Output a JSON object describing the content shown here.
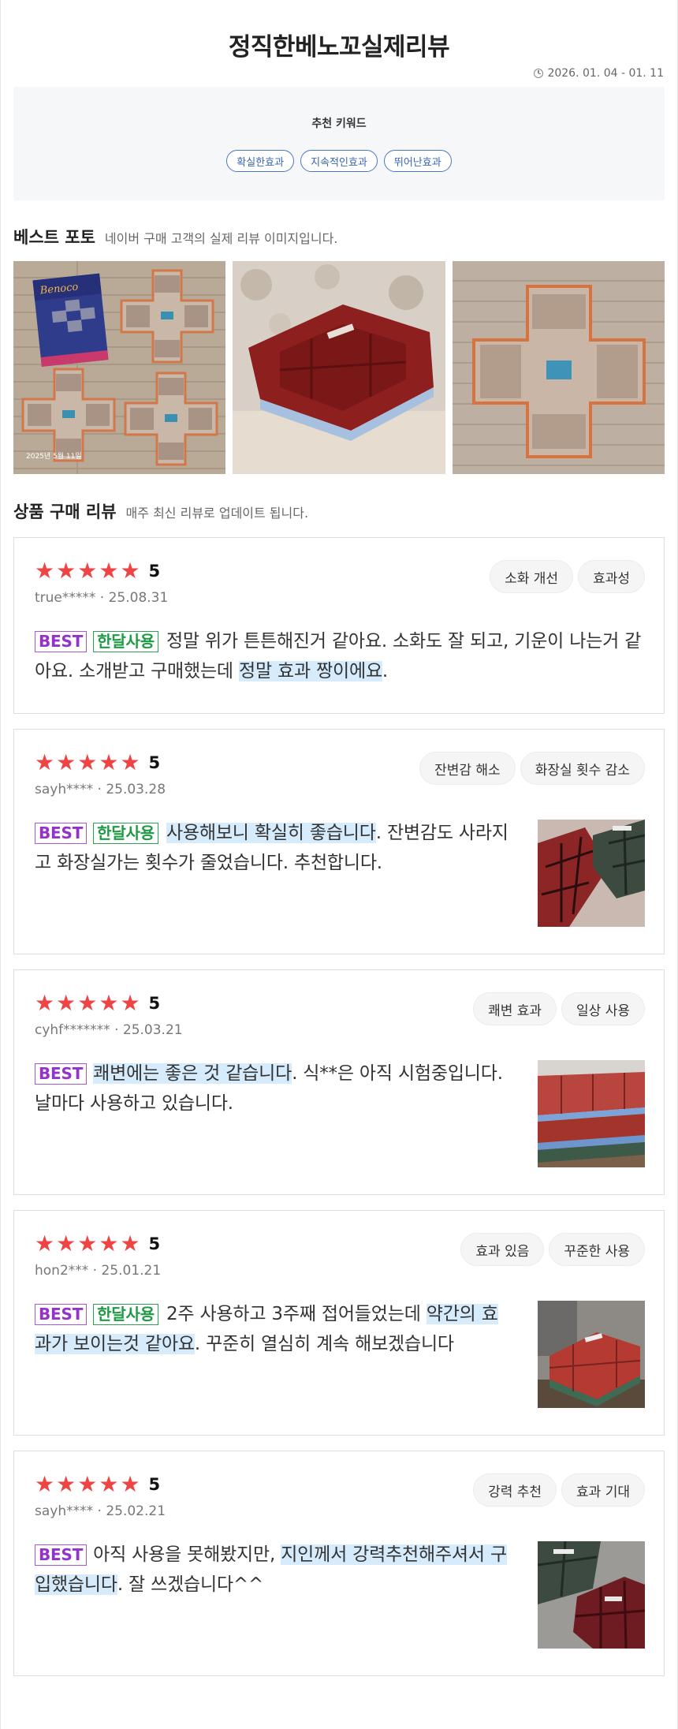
{
  "header": {
    "title": "정직한베노꼬실제리뷰",
    "date_range": "2026. 01. 04 - 01. 11"
  },
  "keywords": {
    "title": "추천 키워드",
    "items": [
      "확실한효과",
      "지속적인효과",
      "뛰어난효과"
    ]
  },
  "best_photos": {
    "heading": "베스트 포토",
    "subheading": "네이버 구매 고객의 실제 리뷰 이미지입니다.",
    "first_photo_stamp": "2025년 5월 11일"
  },
  "reviews_section": {
    "heading": "상품 구매 리뷰",
    "subheading": "매주 최신 리뷰로 업데이트 됩니다."
  },
  "reviews": [
    {
      "rating": "5",
      "user": "true*****",
      "date": "25.08.31",
      "tags": [
        "소화 개선",
        "효과성"
      ],
      "best": "BEST",
      "month": "한달사용",
      "text_a": "정말 위가 튼튼해진거 같아요. 소화도 잘 되고, 기운이 나는거 같아요. 소개받고 구매했는데 ",
      "hl_a": "정말 효과 짱이에요",
      "text_b": "."
    },
    {
      "rating": "5",
      "user": "sayh****",
      "date": "25.03.28",
      "tags": [
        "잔변감 해소",
        "화장실 횟수 감소"
      ],
      "best": "BEST",
      "month": "한달사용",
      "hl_a": "사용해보니 확실히 좋습니다",
      "text_b": ". 잔변감도 사라지고 화장실가는 횟수가 줄었습니다. 추천합니다."
    },
    {
      "rating": "5",
      "user": "cyhf*******",
      "date": "25.03.21",
      "tags": [
        "쾌변 효과",
        "일상 사용"
      ],
      "best": "BEST",
      "hl_a": "쾌변에는 좋은 것 같습니다",
      "text_b": ". 식**은 아직 시험중입니다. 날마다 사용하고 있습니다."
    },
    {
      "rating": "5",
      "user": "hon2***",
      "date": "25.01.21",
      "tags": [
        "효과 있음",
        "꾸준한 사용"
      ],
      "best": "BEST",
      "month": "한달사용",
      "text_a": "2주 사용하고 3주째 접어들었는데 ",
      "hl_a": "약간의 효과가 보이는것 같아요",
      "text_b": ". 꾸준히 열심히 계속 해보겠습니다"
    },
    {
      "rating": "5",
      "user": "sayh****",
      "date": "25.02.21",
      "tags": [
        "강력 추천",
        "효과 기대"
      ],
      "best": "BEST",
      "text_a": "아직 사용을 못해봤지만, ",
      "hl_a": "지인께서 강력추천해주셔서 구입했습니다",
      "text_b": ". 잘 쓰겠습니다^^"
    }
  ],
  "colors": {
    "star": "#ee4444",
    "best_badge": "#9333c9",
    "month_badge": "#1f9a44",
    "highlight": "#d6ebfb",
    "keyword_chip": "#3a66b6"
  }
}
